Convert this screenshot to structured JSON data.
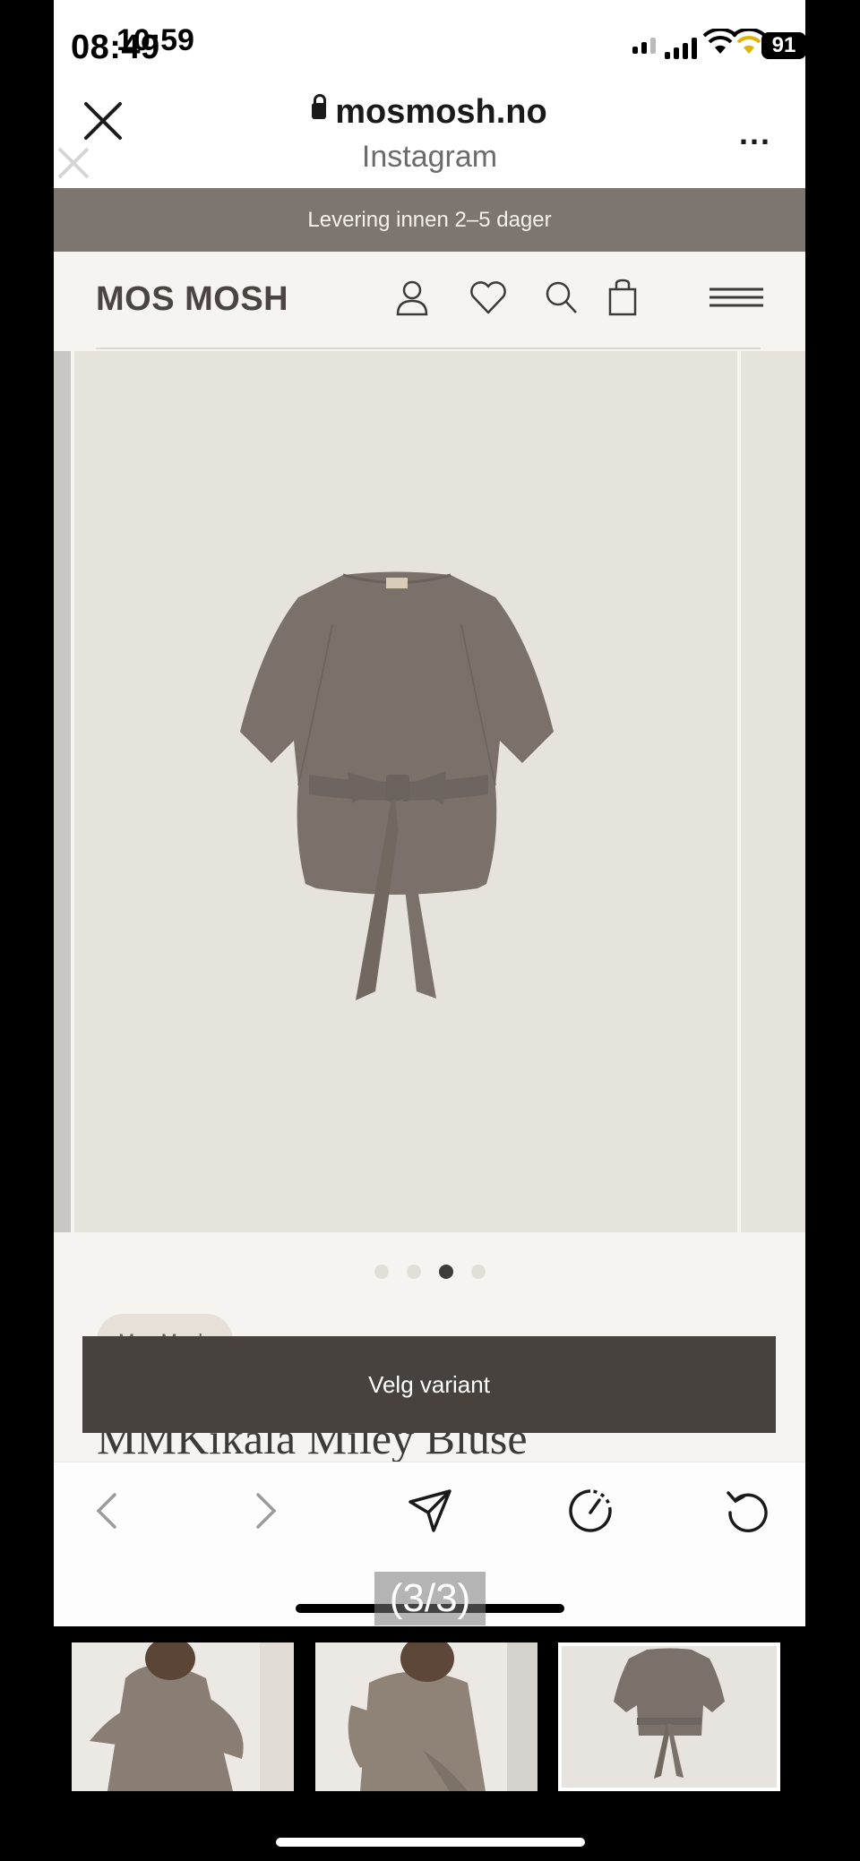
{
  "status_bar": {
    "time_overlay_a": "08:49",
    "time_overlay_b": "10:59",
    "battery": "91"
  },
  "browser": {
    "domain": "mosmosh.no",
    "source": "Instagram",
    "more_label": "..."
  },
  "promo": {
    "text": "Levering innen 2–5 dager"
  },
  "site": {
    "logo": "MOS MOSH",
    "icons": [
      "account-icon",
      "heart-icon",
      "search-icon",
      "bag-icon",
      "menu-icon"
    ]
  },
  "gallery": {
    "total_images": 4,
    "active_index": 3
  },
  "product": {
    "brand_chip": "Mos Mosh",
    "title": "MMKikala Miley Bluse",
    "cta": "Velg variant"
  },
  "toolbar": {
    "icons": [
      "back-icon",
      "forward-icon",
      "share-icon",
      "speed-icon",
      "reload-icon"
    ],
    "counter": "(3/3)"
  },
  "thumbnails": {
    "count": 3,
    "selected": 3
  },
  "colors": {
    "promo_bg": "#7d7570",
    "header_bg": "#f6f4f1",
    "image_bg": "#e6e2dc",
    "garment": "#7a716a",
    "cta_bg": "#47423d"
  }
}
